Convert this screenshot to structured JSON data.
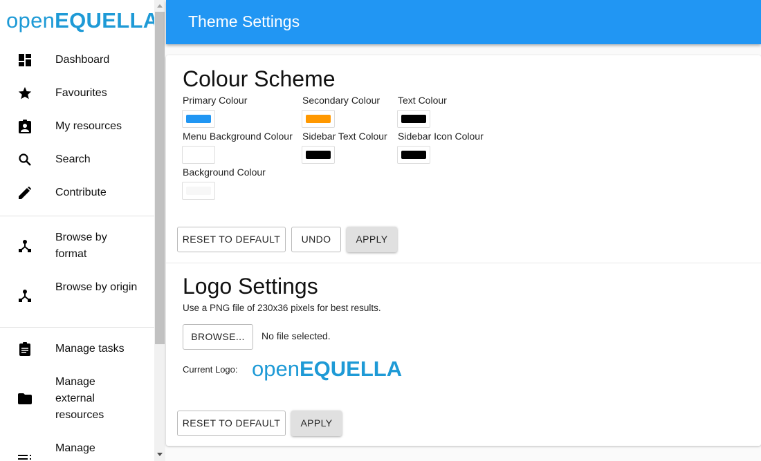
{
  "sidebar": {
    "logo": {
      "light": "open",
      "bold": "EQUELLA"
    },
    "items": [
      {
        "label": "Dashboard",
        "icon": "dashboard-icon"
      },
      {
        "label": "Favourites",
        "icon": "star-icon"
      },
      {
        "label": "My resources",
        "icon": "assignment-ind-icon"
      },
      {
        "label": "Search",
        "icon": "search-icon"
      },
      {
        "label": "Contribute",
        "icon": "pencil-icon"
      },
      {
        "label": "Browse by format",
        "icon": "hierarchy-icon"
      },
      {
        "label": "Browse by origin",
        "icon": "hierarchy-icon"
      },
      {
        "label": "Manage tasks",
        "icon": "clipboard-icon"
      },
      {
        "label": "Manage external resources",
        "icon": "folder-icon"
      },
      {
        "label": "Manage",
        "icon": "list-icon"
      }
    ]
  },
  "header": {
    "title": "Theme Settings",
    "color": "#2196f3"
  },
  "colour_scheme": {
    "title": "Colour Scheme",
    "colours": [
      {
        "label": "Primary Colour",
        "value": "#2196f3"
      },
      {
        "label": "Secondary Colour",
        "value": "#ff9800"
      },
      {
        "label": "Text Colour",
        "value": "#000000"
      },
      {
        "label": "Menu Background Colour",
        "value": "#ffffff"
      },
      {
        "label": "Sidebar Text Colour",
        "value": "#000000"
      },
      {
        "label": "Sidebar Icon Colour",
        "value": "#000000"
      },
      {
        "label": "Background Colour",
        "value": "#fafafa"
      }
    ],
    "reset": "RESET TO DEFAULT",
    "undo": "UNDO",
    "apply": "APPLY"
  },
  "logo_settings": {
    "title": "Logo Settings",
    "hint": "Use a PNG file of 230x36 pixels for best results.",
    "browse": "BROWSE...",
    "file_status": "No file selected.",
    "current_label": "Current Logo:",
    "current_logo": {
      "light": "open",
      "bold": "EQUELLA"
    },
    "reset": "RESET TO DEFAULT",
    "apply": "APPLY"
  }
}
